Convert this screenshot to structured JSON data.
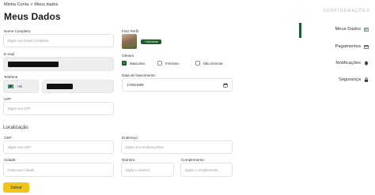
{
  "breadcrumb": {
    "parent": "Minha Conta",
    "separator": ">",
    "current": "Meus dados"
  },
  "page_title": "Meus Dados",
  "form": {
    "full_name": {
      "label": "Nome Completo:",
      "placeholder": "Digite seu Nome Completo"
    },
    "email": {
      "label": "E-mail"
    },
    "phone": {
      "label": "Telefone",
      "country_code": "+55"
    },
    "cpf": {
      "label": "CPF",
      "placeholder": "Digite seu CPF"
    },
    "photo": {
      "label": "Foto Perfil",
      "add_label": "+ Adicionar"
    },
    "gender": {
      "label": "Gênero",
      "options": [
        {
          "label": "Masculino",
          "checked": true
        },
        {
          "label": "Feminino",
          "checked": false
        },
        {
          "label": "Não informar",
          "checked": false
        }
      ]
    },
    "birth_date": {
      "label": "Data de Nascimento:",
      "value": "17/08/1999"
    }
  },
  "location": {
    "title": "Localização",
    "cep": {
      "label": "CEP:",
      "placeholder": "Digite seu CEP"
    },
    "address": {
      "label": "Endereço:",
      "placeholder": "Digite seu Endereço/Rua"
    },
    "city": {
      "label": "Cidade:",
      "placeholder": "Insira sua Cidade"
    },
    "number": {
      "label": "Número:",
      "placeholder": "Digite o número"
    },
    "complement": {
      "label": "Complemento:",
      "placeholder": "Digite o complemento"
    }
  },
  "save_button": "Salvar",
  "sidebar": {
    "header": "CONFIGURAÇÕES",
    "items": [
      {
        "label": "Meus Dados",
        "icon": "id-card-icon",
        "active": true
      },
      {
        "label": "Pagamentos",
        "icon": "credit-card-icon",
        "active": false
      },
      {
        "label": "Notificações",
        "icon": "bell-icon",
        "active": false
      },
      {
        "label": "Segurança",
        "icon": "lock-icon",
        "active": false
      }
    ]
  },
  "colors": {
    "accent_green": "#1f5c2c",
    "save_yellow": "#f0c419",
    "field_border": "#e3e3e3"
  }
}
